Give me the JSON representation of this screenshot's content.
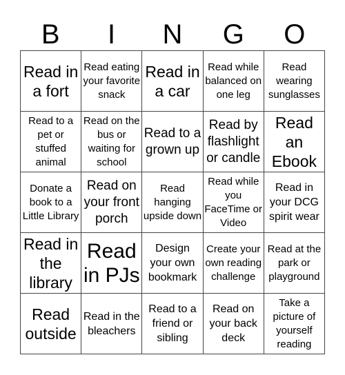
{
  "header": {
    "letters": [
      "B",
      "I",
      "N",
      "G",
      "O"
    ]
  },
  "cells": [
    {
      "text": "Read in a fort",
      "size": "l"
    },
    {
      "text": "Read eating your favorite snack",
      "size": "xs"
    },
    {
      "text": "Read in a car",
      "size": "l"
    },
    {
      "text": "Read while balanced on one leg",
      "size": "xs"
    },
    {
      "text": "Read wearing sunglasses",
      "size": "xs"
    },
    {
      "text": "Read to a pet or stuffed animal",
      "size": "xs"
    },
    {
      "text": "Read on the bus or waiting for school",
      "size": "xs"
    },
    {
      "text": "Read to a grown up",
      "size": "m"
    },
    {
      "text": "Read by flashlight or candle",
      "size": "m"
    },
    {
      "text": "Read an Ebook",
      "size": "l"
    },
    {
      "text": "Donate a book to a Little Library",
      "size": "xs"
    },
    {
      "text": "Read on your front porch",
      "size": "m"
    },
    {
      "text": "Read hanging upside down",
      "size": "xs"
    },
    {
      "text": "Read while you FaceTime or Video",
      "size": "xs"
    },
    {
      "text": "Read in your DCG spirit wear",
      "size": "s"
    },
    {
      "text": "Read in the library",
      "size": "l"
    },
    {
      "text": "Read in PJs",
      "size": "xl"
    },
    {
      "text": "Design your own bookmark",
      "size": "s"
    },
    {
      "text": "Create your own reading challenge",
      "size": "xs"
    },
    {
      "text": "Read at the park or playground",
      "size": "xs"
    },
    {
      "text": "Read outside",
      "size": "l"
    },
    {
      "text": "Read in the bleachers",
      "size": "s"
    },
    {
      "text": "Read to a friend or sibling",
      "size": "s"
    },
    {
      "text": "Read on your back deck",
      "size": "s"
    },
    {
      "text": "Take a picture of yourself reading",
      "size": "xs"
    }
  ]
}
